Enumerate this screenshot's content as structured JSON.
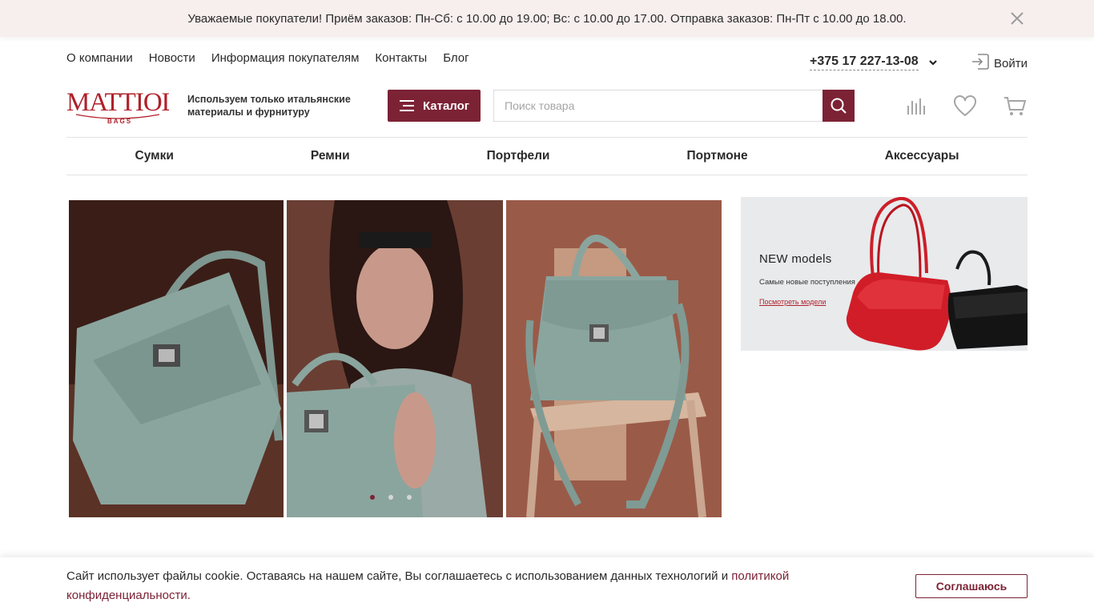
{
  "notice": {
    "text": "Уважаемые покупатели! Приём заказов: Пн-Сб: с 10.00 до 19.00; Вс: с 10.00 до 17.00. Отправка заказов: Пн-Пт с 10.00 до 18.00.",
    "close_icon": "close-icon"
  },
  "top_nav": {
    "items": [
      {
        "label": "О компании"
      },
      {
        "label": "Новости"
      },
      {
        "label": "Информация покупателям"
      },
      {
        "label": "Контакты"
      },
      {
        "label": "Блог"
      }
    ]
  },
  "contact": {
    "phone": "+375 17 227-13-08"
  },
  "account": {
    "login_label": "Войти"
  },
  "header": {
    "logo_text": "MATTIOLI",
    "logo_sub": "BAGS",
    "tagline": "Используем только итальянские материалы и фурнитуру",
    "catalog_label": "Каталог",
    "search_placeholder": "Поиск товара"
  },
  "categories": [
    {
      "label": "Сумки"
    },
    {
      "label": "Ремни"
    },
    {
      "label": "Портфели"
    },
    {
      "label": "Портмоне"
    },
    {
      "label": "Аксессуары"
    }
  ],
  "slider": {
    "total_slides": 3,
    "active_slide": 1
  },
  "promo_banner": {
    "title": "NEW models",
    "subtitle": "Самые новые поступления",
    "link": "Посмотреть модели"
  },
  "cookie": {
    "text": "Сайт использует файлы cookie. Оставаясь на нашем сайте, Вы соглашаетесь с использованием данных технологий и ",
    "link": "политикой конфиденциальности.",
    "agree_label": "Соглашаюсь"
  },
  "colors": {
    "brand": "#7c2235",
    "notice_bg": "#f7eeee",
    "bag_mint": "#8aa59e"
  }
}
